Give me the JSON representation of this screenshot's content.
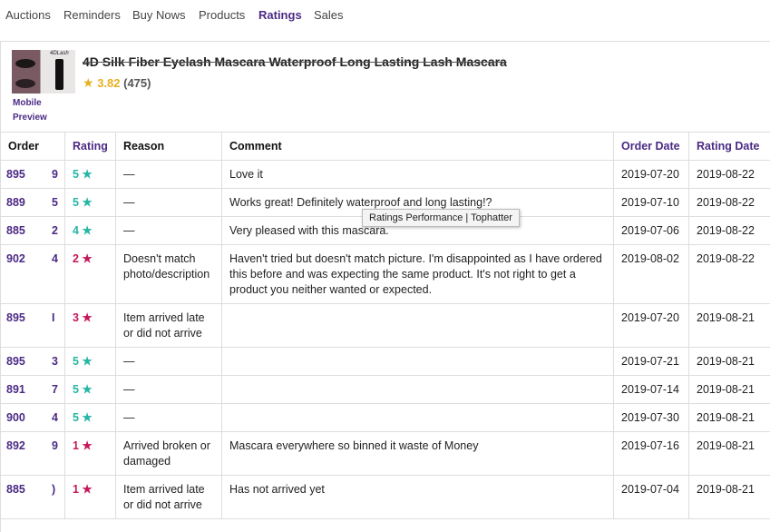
{
  "nav": {
    "items": [
      {
        "label": "Auctions",
        "active": false
      },
      {
        "label": "Reminders",
        "active": false
      },
      {
        "label": "Buy Nows",
        "active": false
      },
      {
        "label": "Products",
        "active": false
      },
      {
        "label": "Ratings",
        "active": true
      },
      {
        "label": "Sales",
        "active": false
      }
    ]
  },
  "product": {
    "title": "4D Silk Fiber Eyelash Mascara Waterproof Long Lasting Lash Mascara",
    "average_rating": "3.82",
    "rating_count": "(475)",
    "mobile_preview_label": "Mobile Preview",
    "thumb_brand": "4DLash"
  },
  "table": {
    "headers": {
      "order": "Order",
      "rating": "Rating",
      "reason": "Reason",
      "comment": "Comment",
      "order_date": "Order Date",
      "rating_date": "Rating Date"
    },
    "rows": [
      {
        "order_head": "895",
        "order_tail": "9",
        "rating": "5",
        "reason": "—",
        "comment": "Love it",
        "order_date": "2019-07-20",
        "rating_date": "2019-08-22"
      },
      {
        "order_head": "889",
        "order_tail": "5",
        "rating": "5",
        "reason": "—",
        "comment": "Works great! Definitely waterproof and long lasting!?",
        "order_date": "2019-07-10",
        "rating_date": "2019-08-22"
      },
      {
        "order_head": "885",
        "order_tail": "2",
        "rating": "4",
        "reason": "—",
        "comment": "Very pleased with this mascara.",
        "order_date": "2019-07-06",
        "rating_date": "2019-08-22"
      },
      {
        "order_head": "902",
        "order_tail": "4",
        "rating": "2",
        "reason": "Doesn't match photo/description",
        "comment": "Haven't tried but doesn't match picture. I'm disappointed as I have ordered this before and was expecting the same product. It's not right to get a product you neither wanted or expected.",
        "order_date": "2019-08-02",
        "rating_date": "2019-08-22"
      },
      {
        "order_head": "895",
        "order_tail": "I",
        "rating": "3",
        "reason": "Item arrived late or did not arrive",
        "comment": "",
        "order_date": "2019-07-20",
        "rating_date": "2019-08-21"
      },
      {
        "order_head": "895",
        "order_tail": "3",
        "rating": "5",
        "reason": "—",
        "comment": "",
        "order_date": "2019-07-21",
        "rating_date": "2019-08-21"
      },
      {
        "order_head": "891",
        "order_tail": "7",
        "rating": "5",
        "reason": "—",
        "comment": "",
        "order_date": "2019-07-14",
        "rating_date": "2019-08-21"
      },
      {
        "order_head": "900",
        "order_tail": "4",
        "rating": "5",
        "reason": "—",
        "comment": "",
        "order_date": "2019-07-30",
        "rating_date": "2019-08-21"
      },
      {
        "order_head": "892",
        "order_tail": "9",
        "rating": "1",
        "reason": "Arrived broken or damaged",
        "comment": "Mascara everywhere so binned it waste of Money",
        "order_date": "2019-07-16",
        "rating_date": "2019-08-21"
      },
      {
        "order_head": "885",
        "order_tail": ")",
        "rating": "1",
        "reason": "Item arrived late or did not arrive",
        "comment": "Has not arrived yet",
        "order_date": "2019-07-04",
        "rating_date": "2019-08-21"
      }
    ]
  },
  "tooltip": {
    "text": "Ratings Performance | Tophatter"
  },
  "colors": {
    "accent": "#4b2a85",
    "rating_high": "#27b5a5",
    "rating_low": "#c4185a",
    "star_gold": "#e8b020"
  }
}
